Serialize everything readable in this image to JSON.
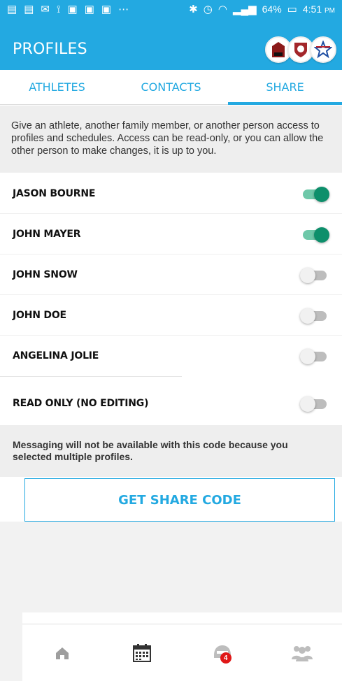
{
  "status": {
    "battery_percent": "64%",
    "time": "4:51",
    "ampm": "PM"
  },
  "header": {
    "title": "PROFILES"
  },
  "tabs": [
    {
      "label": "ATHLETES",
      "active": false
    },
    {
      "label": "CONTACTS",
      "active": false
    },
    {
      "label": "SHARE",
      "active": true
    }
  ],
  "description": "Give an athlete, another family member, or another person access to profiles and schedules. Access can be read-only, or you can allow the other person to make changes, it is up to you.",
  "profiles": [
    {
      "name": "JASON BOURNE",
      "enabled": true
    },
    {
      "name": "JOHN MAYER",
      "enabled": true
    },
    {
      "name": "JOHN SNOW",
      "enabled": false
    },
    {
      "name": "JOHN DOE",
      "enabled": false
    },
    {
      "name": "ANGELINA JOLIE",
      "enabled": false
    }
  ],
  "read_only": {
    "label": "READ ONLY (NO EDITING)",
    "enabled": false
  },
  "note": "Messaging will not be available with this code because you selected multiple profiles.",
  "share_button": {
    "label": "GET SHARE CODE"
  },
  "bottom_nav": {
    "items": [
      "home-icon",
      "calendar-icon",
      "helmet-icon",
      "team-icon"
    ],
    "badge": "4"
  },
  "colors": {
    "accent": "#23a9e1",
    "toggle_on": "#0d8f6b",
    "badge": "#e01717"
  }
}
